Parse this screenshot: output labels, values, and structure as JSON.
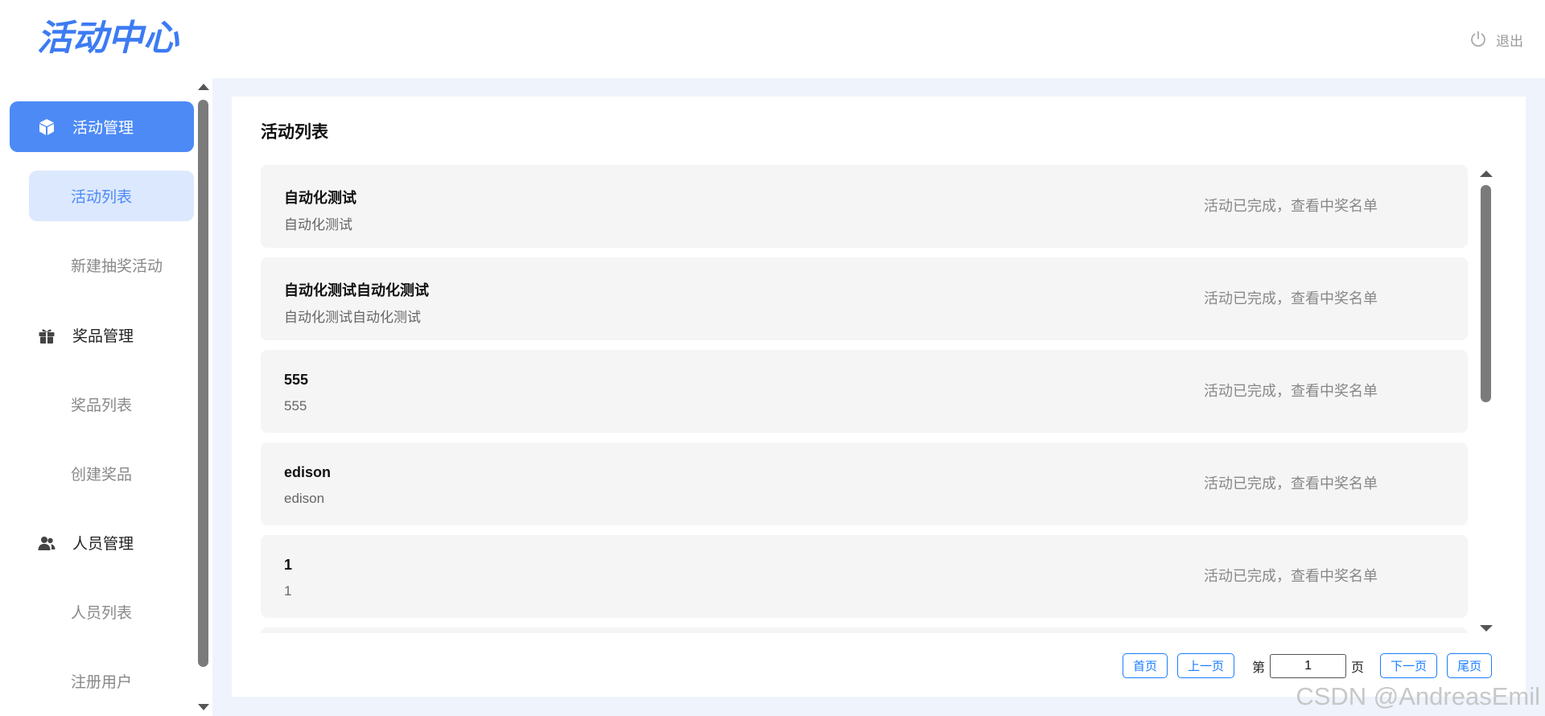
{
  "header": {
    "logo_text": "活动中心",
    "logout_label": "退出"
  },
  "sidebar": {
    "groups": [
      {
        "label": "活动管理",
        "icon": "cube-icon",
        "active": true,
        "items": [
          {
            "label": "活动列表",
            "active": true
          },
          {
            "label": "新建抽奖活动",
            "active": false
          }
        ]
      },
      {
        "label": "奖品管理",
        "icon": "gift-icon",
        "active": false,
        "items": [
          {
            "label": "奖品列表",
            "active": false
          },
          {
            "label": "创建奖品",
            "active": false
          }
        ]
      },
      {
        "label": "人员管理",
        "icon": "users-icon",
        "active": false,
        "items": [
          {
            "label": "人员列表",
            "active": false
          },
          {
            "label": "注册用户",
            "active": false
          }
        ]
      }
    ]
  },
  "main": {
    "title": "活动列表",
    "activities": [
      {
        "name": "自动化测试",
        "desc": "自动化测试",
        "status": "活动已完成，查看中奖名单"
      },
      {
        "name": "自动化测试自动化测试",
        "desc": "自动化测试自动化测试",
        "status": "活动已完成，查看中奖名单"
      },
      {
        "name": "555",
        "desc": "555",
        "status": "活动已完成，查看中奖名单"
      },
      {
        "name": "edison",
        "desc": "edison",
        "status": "活动已完成，查看中奖名单"
      },
      {
        "name": "1",
        "desc": "1",
        "status": "活动已完成，查看中奖名单"
      }
    ]
  },
  "pagination": {
    "first_label": "首页",
    "prev_label": "上一页",
    "page_prefix": "第",
    "current_page": "1",
    "page_suffix": "页",
    "next_label": "下一页",
    "last_label": "尾页"
  },
  "watermark": "CSDN @AndreasEmil",
  "colors": {
    "accent": "#4d8af6",
    "active_sub_bg": "#dce8fd",
    "main_bg": "#eff3fb",
    "card_bg": "#f5f5f5",
    "pager_blue": "#1a7dff"
  }
}
